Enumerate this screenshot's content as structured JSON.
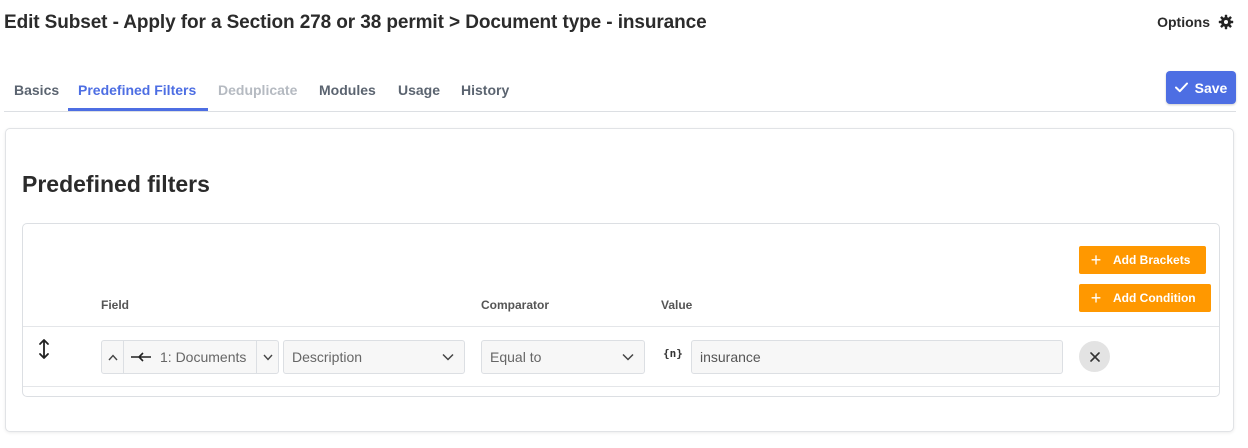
{
  "header": {
    "title": "Edit Subset - Apply for a Section 278 or 38 permit > Document type - insurance",
    "options_label": "Options"
  },
  "tabs": [
    {
      "label": "Basics",
      "state": "normal"
    },
    {
      "label": "Predefined Filters",
      "state": "active"
    },
    {
      "label": "Deduplicate",
      "state": "disabled"
    },
    {
      "label": "Modules",
      "state": "normal"
    },
    {
      "label": "Usage",
      "state": "normal"
    },
    {
      "label": "History",
      "state": "normal"
    }
  ],
  "save_label": "Save",
  "card": {
    "title": "Predefined filters",
    "add_brackets_label": "Add Brackets",
    "add_condition_label": "Add Condition",
    "columns": {
      "field": "Field",
      "comparator": "Comparator",
      "value": "Value"
    },
    "filter_row": {
      "field_source": "1: Documents",
      "field_name": "Description",
      "comparator": "Equal to",
      "variable_icon": "{n}",
      "value": "insurance"
    }
  },
  "colors": {
    "accent": "#4d6ee3",
    "orange": "#ff9800",
    "disabled": "#b5bac1"
  },
  "icons": {
    "options": "gear-icon",
    "save": "check-icon",
    "drag": "vertical-arrows-icon",
    "relation": "relation-arrow-icon",
    "remove": "close-icon"
  }
}
